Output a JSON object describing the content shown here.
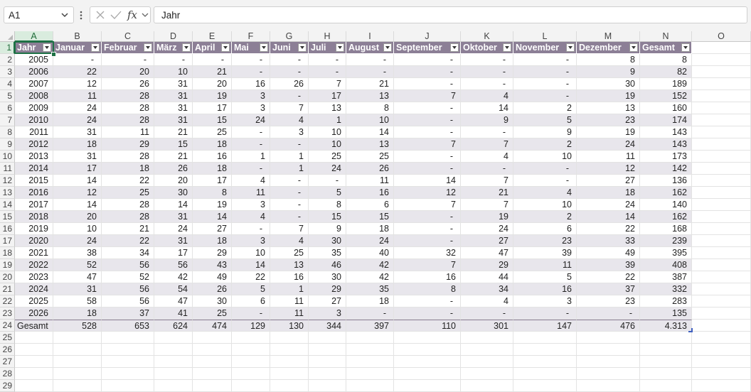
{
  "formula_bar": {
    "name_box": "A1",
    "formula": "Jahr",
    "fx_label": "fx"
  },
  "columns": [
    "A",
    "B",
    "C",
    "D",
    "E",
    "F",
    "G",
    "H",
    "I",
    "J",
    "K",
    "L",
    "M",
    "N",
    "O"
  ],
  "table": {
    "headers": [
      "Jahr",
      "Januar",
      "Februar",
      "März",
      "April",
      "Mai",
      "Juni",
      "Juli",
      "August",
      "September",
      "Oktober",
      "November",
      "Dezember",
      "Gesamt"
    ],
    "rows": [
      [
        "2005",
        "-",
        "-",
        "-",
        "-",
        "-",
        "-",
        "-",
        "-",
        "-",
        "-",
        "-",
        "8",
        "8"
      ],
      [
        "2006",
        "22",
        "20",
        "10",
        "21",
        "-",
        "-",
        "-",
        "-",
        "-",
        "-",
        "-",
        "9",
        "82"
      ],
      [
        "2007",
        "12",
        "26",
        "31",
        "20",
        "16",
        "26",
        "7",
        "21",
        "-",
        "-",
        "-",
        "30",
        "189"
      ],
      [
        "2008",
        "11",
        "28",
        "31",
        "19",
        "3",
        "-",
        "17",
        "13",
        "7",
        "4",
        "-",
        "19",
        "152"
      ],
      [
        "2009",
        "24",
        "28",
        "31",
        "17",
        "3",
        "7",
        "13",
        "8",
        "-",
        "14",
        "2",
        "13",
        "160"
      ],
      [
        "2010",
        "24",
        "28",
        "31",
        "15",
        "24",
        "4",
        "1",
        "10",
        "-",
        "9",
        "5",
        "23",
        "174"
      ],
      [
        "2011",
        "31",
        "11",
        "21",
        "25",
        "-",
        "3",
        "10",
        "14",
        "-",
        "-",
        "9",
        "19",
        "143"
      ],
      [
        "2012",
        "18",
        "29",
        "15",
        "18",
        "-",
        "-",
        "10",
        "13",
        "7",
        "7",
        "2",
        "24",
        "143"
      ],
      [
        "2013",
        "31",
        "28",
        "21",
        "16",
        "1",
        "1",
        "25",
        "25",
        "-",
        "4",
        "10",
        "11",
        "173"
      ],
      [
        "2014",
        "17",
        "18",
        "26",
        "18",
        "-",
        "1",
        "24",
        "26",
        "-",
        "-",
        "-",
        "12",
        "142"
      ],
      [
        "2015",
        "14",
        "22",
        "20",
        "17",
        "4",
        "-",
        "-",
        "11",
        "14",
        "7",
        "-",
        "27",
        "136"
      ],
      [
        "2016",
        "12",
        "25",
        "30",
        "8",
        "11",
        "-",
        "5",
        "16",
        "12",
        "21",
        "4",
        "18",
        "162"
      ],
      [
        "2017",
        "14",
        "28",
        "14",
        "19",
        "3",
        "-",
        "8",
        "6",
        "7",
        "7",
        "10",
        "24",
        "140"
      ],
      [
        "2018",
        "20",
        "28",
        "31",
        "14",
        "4",
        "-",
        "15",
        "15",
        "-",
        "19",
        "2",
        "14",
        "162"
      ],
      [
        "2019",
        "10",
        "21",
        "24",
        "27",
        "-",
        "7",
        "9",
        "18",
        "-",
        "24",
        "6",
        "22",
        "168"
      ],
      [
        "2020",
        "24",
        "22",
        "31",
        "18",
        "3",
        "4",
        "30",
        "24",
        "-",
        "27",
        "23",
        "33",
        "239"
      ],
      [
        "2021",
        "38",
        "34",
        "17",
        "29",
        "10",
        "25",
        "35",
        "40",
        "32",
        "47",
        "39",
        "49",
        "395"
      ],
      [
        "2022",
        "52",
        "56",
        "56",
        "43",
        "14",
        "13",
        "46",
        "42",
        "7",
        "29",
        "11",
        "39",
        "408"
      ],
      [
        "2023",
        "47",
        "52",
        "42",
        "49",
        "22",
        "16",
        "30",
        "42",
        "16",
        "44",
        "5",
        "22",
        "387"
      ],
      [
        "2024",
        "31",
        "56",
        "54",
        "26",
        "5",
        "1",
        "29",
        "35",
        "8",
        "34",
        "16",
        "37",
        "332"
      ],
      [
        "2025",
        "58",
        "56",
        "47",
        "30",
        "6",
        "11",
        "27",
        "18",
        "-",
        "4",
        "3",
        "23",
        "283"
      ],
      [
        "2026",
        "18",
        "37",
        "41",
        "25",
        "-",
        "11",
        "3",
        "-",
        "-",
        "-",
        "-",
        "-",
        "135"
      ]
    ],
    "total": [
      "Gesamt",
      "528",
      "653",
      "624",
      "474",
      "129",
      "130",
      "344",
      "397",
      "110",
      "301",
      "147",
      "476",
      "4.313"
    ]
  },
  "row_numbers": [
    "1",
    "2",
    "3",
    "4",
    "5",
    "6",
    "7",
    "8",
    "9",
    "10",
    "11",
    "12",
    "13",
    "14",
    "15",
    "16",
    "17",
    "18",
    "19",
    "20",
    "21",
    "22",
    "23",
    "24",
    "25",
    "26",
    "27",
    "28",
    "29"
  ],
  "colors": {
    "header_fill": "#8c7f96",
    "band_fill": "#e8e6ec",
    "selection": "#1e7145"
  }
}
